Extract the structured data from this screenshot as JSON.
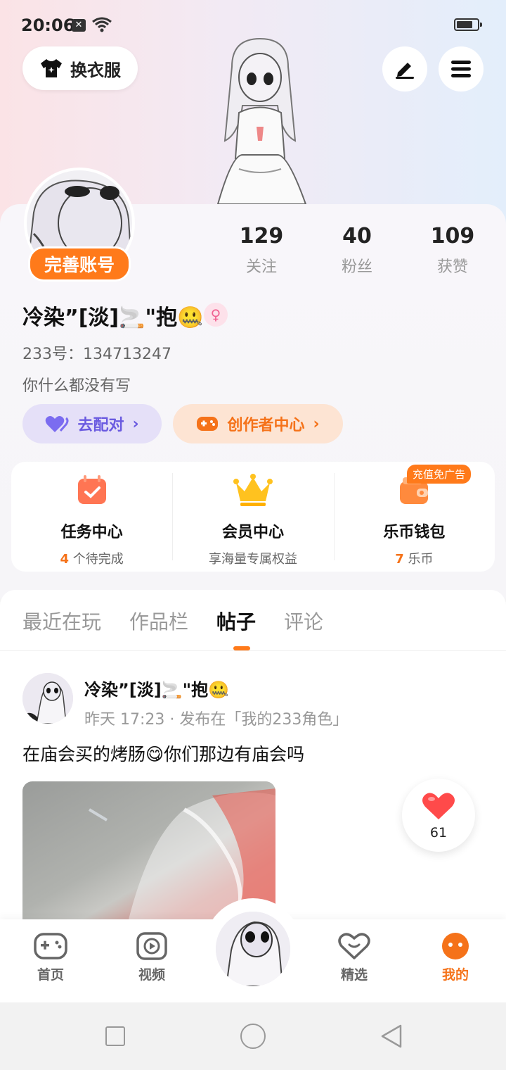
{
  "status_bar": {
    "time": "20:06"
  },
  "header": {
    "outfit_label": "换衣服"
  },
  "profile": {
    "complete_label": "完善账号",
    "stats": [
      {
        "value": "129",
        "label": "关注"
      },
      {
        "value": "40",
        "label": "粉丝"
      },
      {
        "value": "109",
        "label": "获赞"
      }
    ],
    "username": "冷染”[淡]🚬\"抱🤐",
    "gender_symbol": "♀",
    "uid": "233号：134713247",
    "bio": "你什么都没有写",
    "match_label": "去配对",
    "creator_label": "创作者中心"
  },
  "features": {
    "tasks": {
      "title": "任务中心",
      "count": "4",
      "sub": " 个待完成"
    },
    "vip": {
      "title": "会员中心",
      "sub": "享海量专属权益"
    },
    "wallet": {
      "title": "乐币钱包",
      "count": "7",
      "sub": " 乐币",
      "badge": "充值免广告"
    }
  },
  "tabs": [
    "最近在玩",
    "作品栏",
    "帖子",
    "评论"
  ],
  "active_tab": "帖子",
  "post": {
    "author": "冷染”[淡]🚬\"抱🤐",
    "meta": "昨天 17:23 · 发布在「我的233角色」",
    "text": "在庙会买的烤肠😋你们那边有庙会吗",
    "likes": "61"
  },
  "bottom_nav": {
    "home": "首页",
    "video": "视频",
    "featured": "精选",
    "mine": "我的"
  },
  "colors": {
    "accent": "#ff7a1a",
    "match": "#6a5ae0"
  }
}
